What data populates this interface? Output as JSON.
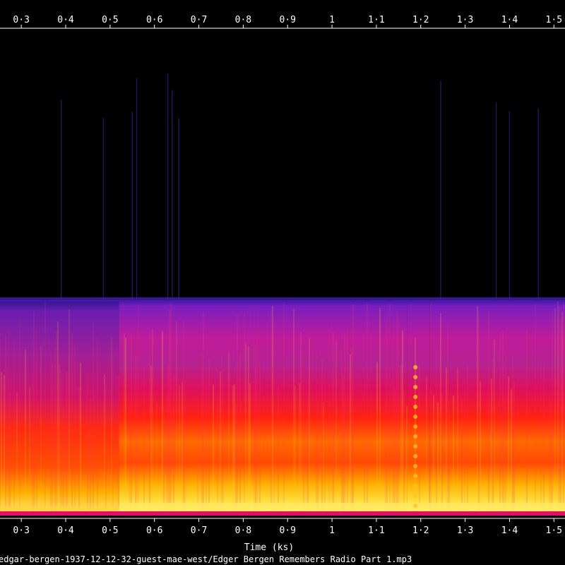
{
  "chart_data": {
    "type": "heatmap",
    "title": "",
    "xlabel": "Time (ks)",
    "ylabel": "",
    "caption": "edgar-bergen-1937-12-12-32-guest-mae-west/Edger Bergen Remembers Radio Part 1.mp3",
    "xlim": [
      0.252,
      1.525
    ],
    "x_ticks": [
      {
        "value": 0.3,
        "label": "0·3"
      },
      {
        "value": 0.4,
        "label": "0·4"
      },
      {
        "value": 0.5,
        "label": "0·5"
      },
      {
        "value": 0.6,
        "label": "0·6"
      },
      {
        "value": 0.7,
        "label": "0·7"
      },
      {
        "value": 0.8,
        "label": "0·8"
      },
      {
        "value": 0.9,
        "label": "0·9"
      },
      {
        "value": 1.0,
        "label": "1"
      },
      {
        "value": 1.1,
        "label": "1·1"
      },
      {
        "value": 1.2,
        "label": "1·2"
      },
      {
        "value": 1.3,
        "label": "1·3"
      },
      {
        "value": 1.4,
        "label": "1·4"
      },
      {
        "value": 1.5,
        "label": "1·5"
      }
    ],
    "colormap": [
      "#000000",
      "#1a0060",
      "#5a1fb0",
      "#b0209a",
      "#e01050",
      "#ff2a00",
      "#ff8a00",
      "#ffd000",
      "#ffff80"
    ],
    "segments": [
      {
        "start": 0.252,
        "end": 0.52,
        "low_band": "bright yellow-orange",
        "mid_band": "red",
        "high_band": "magenta"
      },
      {
        "start": 0.52,
        "end": 1.17,
        "low_band": "yellow",
        "mid_band": "red",
        "high_band": "magenta-purple"
      },
      {
        "start": 1.17,
        "end": 1.22,
        "low_band": "dotted yellow",
        "mid_band": "red",
        "high_band": "magenta"
      },
      {
        "start": 1.22,
        "end": 1.525,
        "low_band": "orange-yellow",
        "mid_band": "red",
        "high_band": "magenta"
      }
    ],
    "grid": false,
    "legend": "none"
  }
}
